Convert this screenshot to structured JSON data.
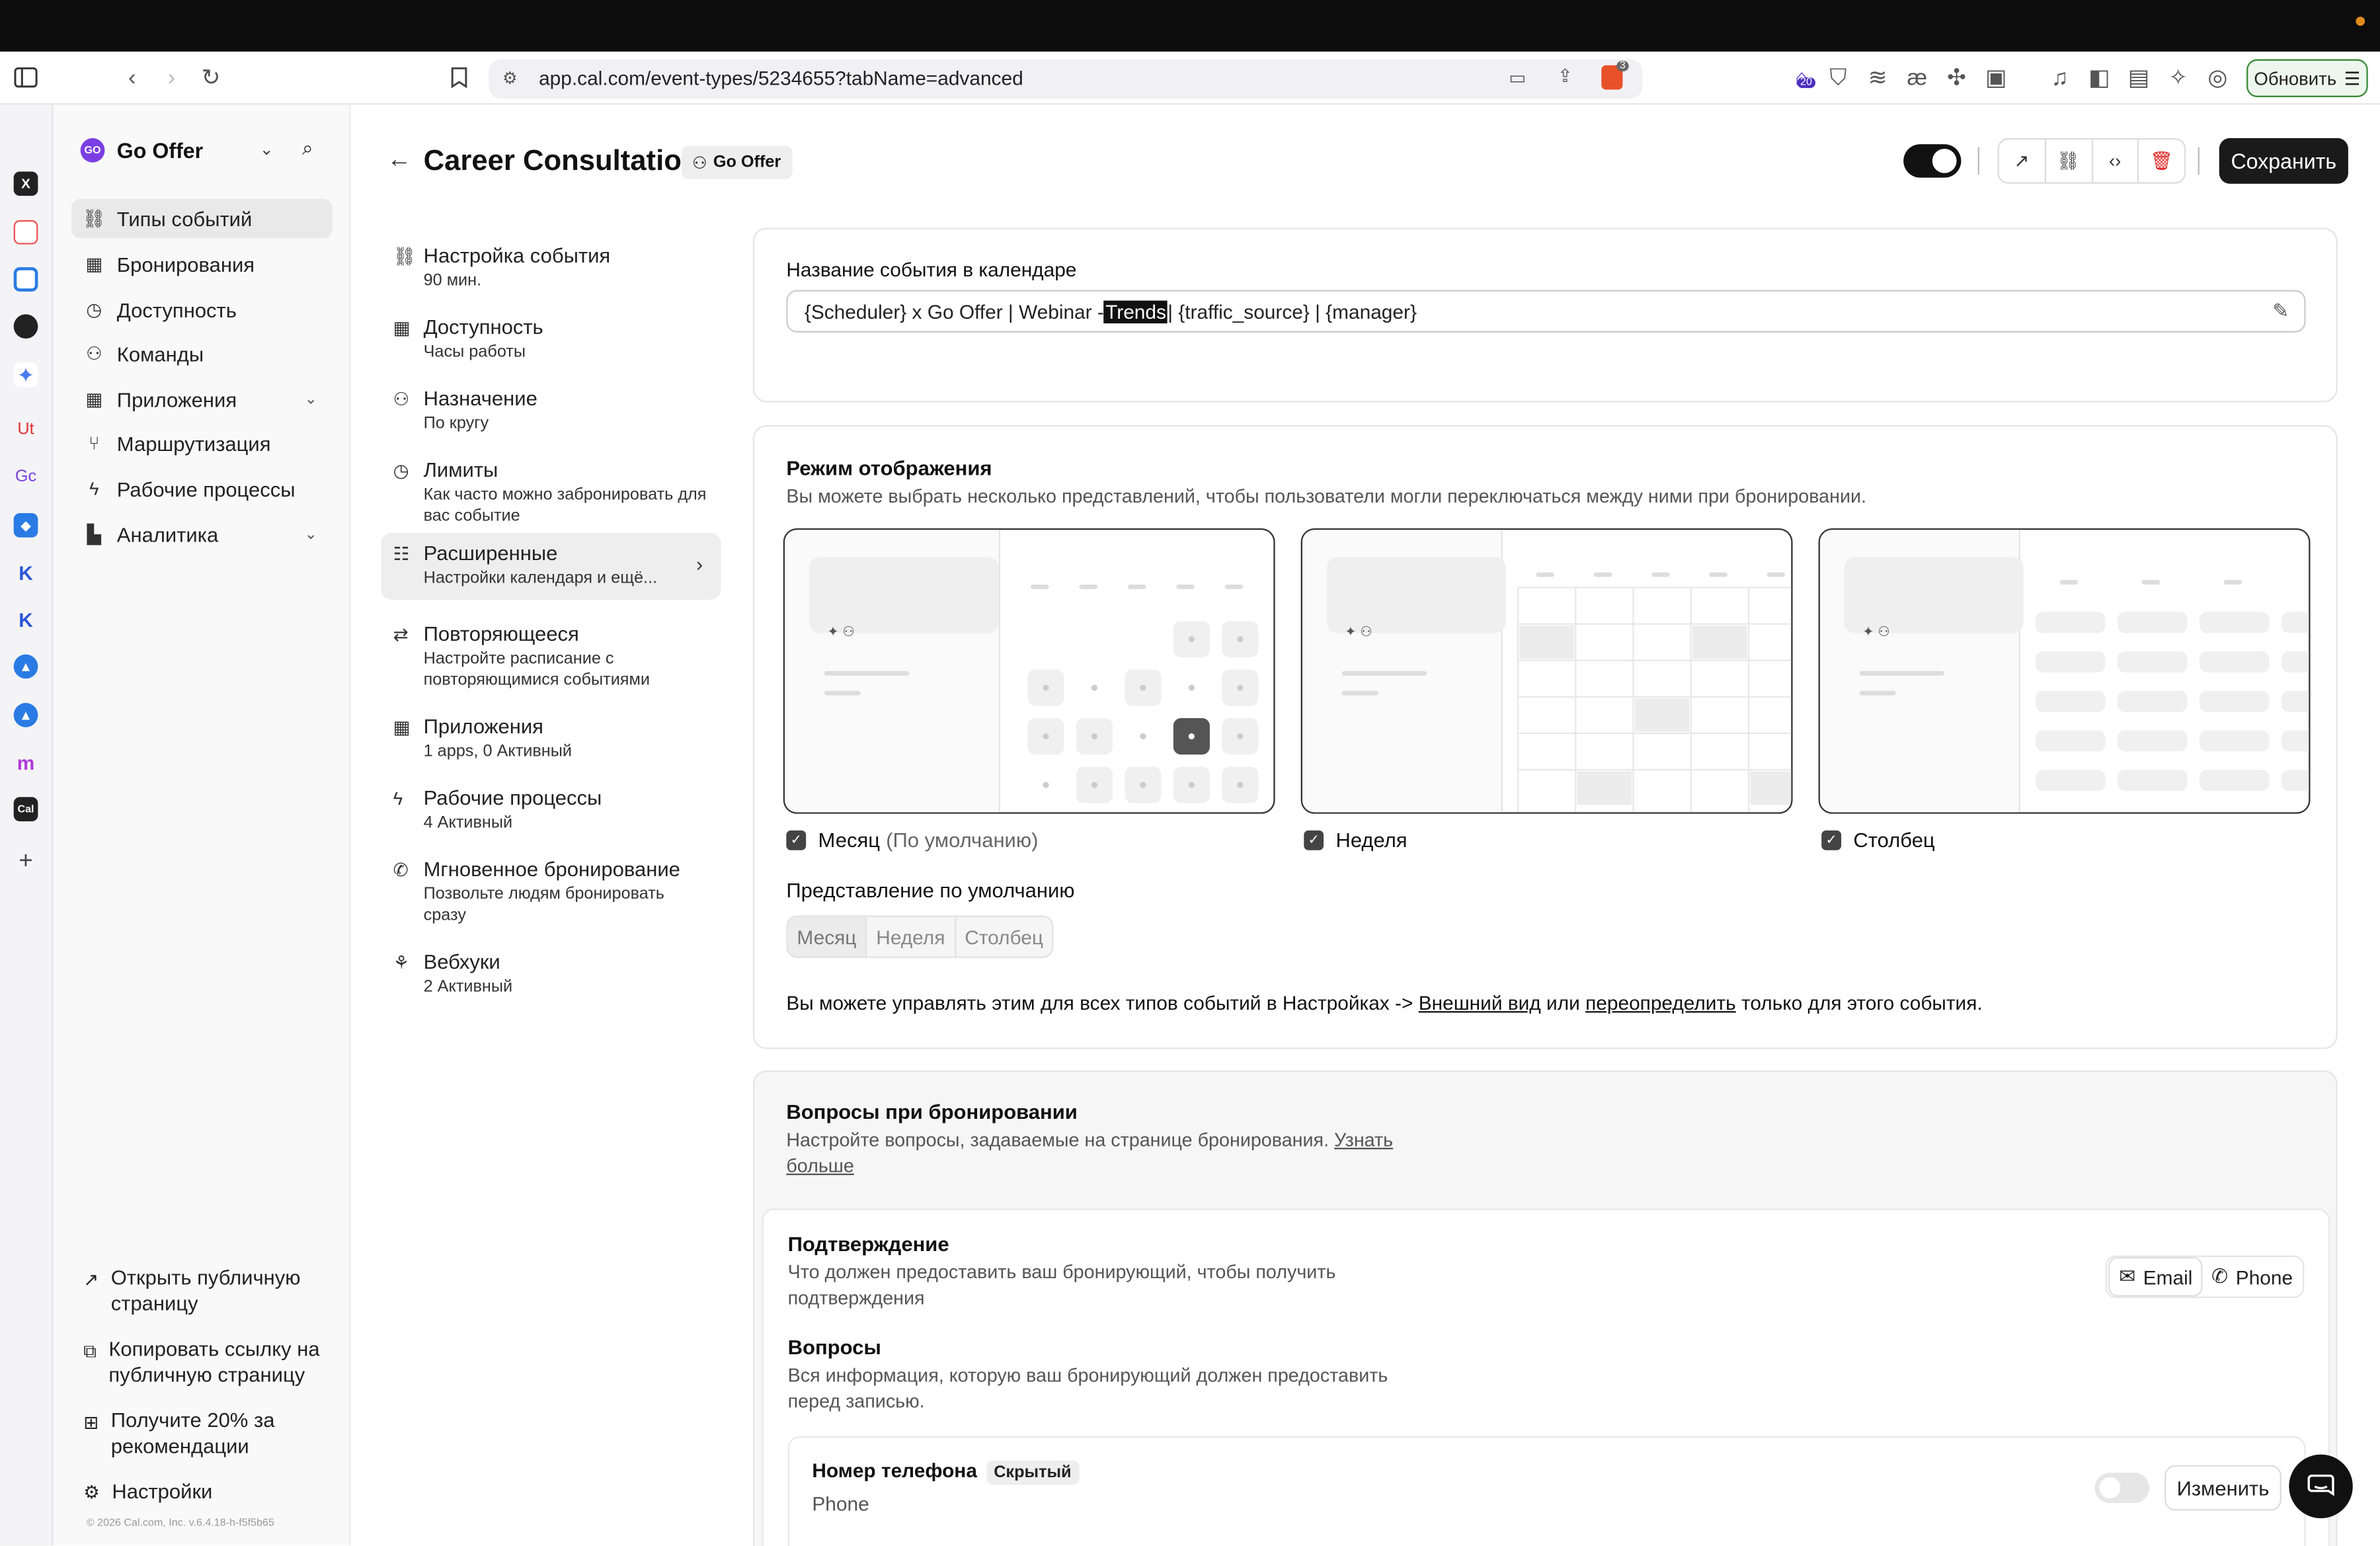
{
  "browser": {
    "url": "app.cal.com/event-types/5234655?tabName=advanced",
    "update_label": "Обновить",
    "brave_count": "3",
    "ext_badge": "20"
  },
  "sidebar_favicons": [
    "Ut",
    "Gc",
    "Cal"
  ],
  "app_nav": {
    "team_name": "Go Offer",
    "team_logo": "GO",
    "items": [
      {
        "label": "Типы событий",
        "icon": "link-icon"
      },
      {
        "label": "Бронирования",
        "icon": "calendar-icon"
      },
      {
        "label": "Доступность",
        "icon": "clock-icon"
      },
      {
        "label": "Команды",
        "icon": "users-icon"
      },
      {
        "label": "Приложения",
        "icon": "grid-icon"
      },
      {
        "label": "Маршрутизация",
        "icon": "split-icon"
      },
      {
        "label": "Рабочие процессы",
        "icon": "zap-icon"
      },
      {
        "label": "Аналитика",
        "icon": "chart-icon"
      }
    ],
    "bottom": {
      "public_page": "Открыть публичную страницу",
      "copy_link": "Копировать ссылку на публичную страницу",
      "referral": "Получите 20% за рекомендации",
      "settings": "Настройки"
    },
    "copyright": "© 2026 Cal.com, Inc. v.6.4.18-h-f5f5b65"
  },
  "header": {
    "title": "Career Consultation",
    "team_badge": "Go Offer",
    "save_label": "Сохранить"
  },
  "sub_nav": [
    {
      "title": "Настройка события",
      "sub": "90 мин.",
      "icon": "link-icon"
    },
    {
      "title": "Доступность",
      "sub": "Часы работы",
      "icon": "calendar-icon"
    },
    {
      "title": "Назначение",
      "sub": "По кругу",
      "icon": "users-icon"
    },
    {
      "title": "Лимиты",
      "sub": "Как часто можно забронировать для вас событие",
      "icon": "clock-icon"
    },
    {
      "title": "Расширенные",
      "sub": "Настройки календаря и ещё...",
      "icon": "sliders-icon"
    },
    {
      "title": "Повторяющееся",
      "sub": "Настройте расписание с повторяющимися событиями",
      "icon": "repeat-icon"
    },
    {
      "title": "Приложения",
      "sub": "1 apps, 0 Активный",
      "icon": "grid-icon"
    },
    {
      "title": "Рабочие процессы",
      "sub": "4 Активный",
      "icon": "zap-icon"
    },
    {
      "title": "Мгновенное бронирование",
      "sub": "Позвольте людям бронировать сразу",
      "icon": "phone-call-icon"
    },
    {
      "title": "Вебхуки",
      "sub": "2 Активный",
      "icon": "webhook-icon"
    }
  ],
  "event_name": {
    "label": "Название события в календаре",
    "value_before": "{Scheduler} x Go Offer | Webinar - ",
    "value_selected": "Trends",
    "value_after": " | {traffic_source} | {manager}"
  },
  "layout": {
    "title": "Режим отображения",
    "description": "Вы можете выбрать несколько представлений, чтобы пользователи могли переключаться между ними при бронировании.",
    "options": [
      {
        "label": "Месяц",
        "suffix": "(По умолчанию)",
        "checked": true
      },
      {
        "label": "Неделя",
        "suffix": "",
        "checked": true
      },
      {
        "label": "Столбец",
        "suffix": "",
        "checked": true
      }
    ],
    "default_label": "Представление по умолчанию",
    "default_options": [
      "Месяц",
      "Неделя",
      "Столбец"
    ],
    "default_selected": "Месяц",
    "note_prefix": "Вы можете управлять этим для всех типов событий в Настройках -> ",
    "note_link1": "Внешний вид",
    "note_mid": " или ",
    "note_link2": "переопределить",
    "note_suffix": " только для этого события."
  },
  "booking_questions": {
    "title": "Вопросы при бронировании",
    "description": "Настройте вопросы, задаваемые на странице бронирования. ",
    "learn_more": "Узнать больше",
    "confirm_title": "Подтверждение",
    "confirm_desc": "Что должен предоставить ваш бронирующий, чтобы получить подтверждения",
    "email_label": "Email",
    "phone_label": "Phone",
    "questions_title": "Вопросы",
    "questions_desc": "Вся информация, которую ваш бронирующий должен предоставить перед записью.",
    "question": {
      "label": "Номер телефона",
      "badge": "Скрытый",
      "type": "Phone",
      "edit_label": "Изменить",
      "enabled": false
    }
  }
}
